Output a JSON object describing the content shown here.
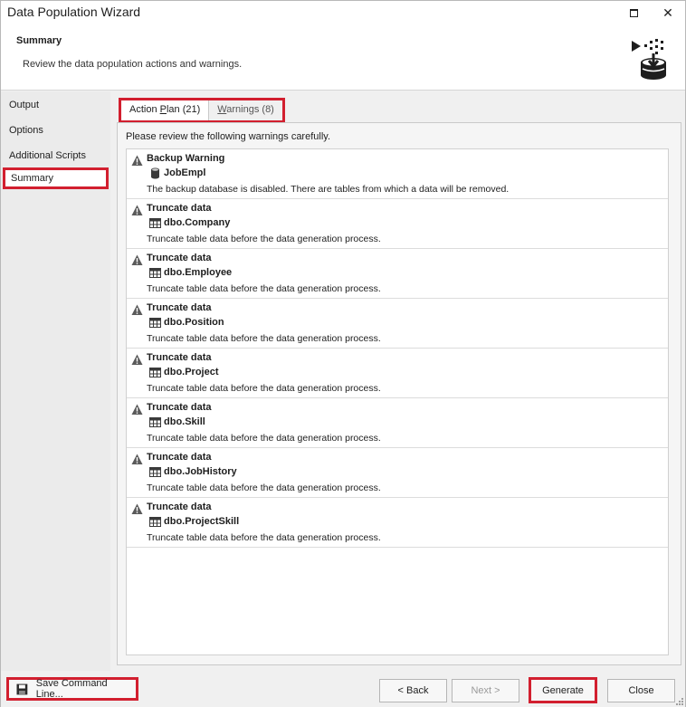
{
  "window": {
    "title": "Data Population Wizard",
    "maximize_icon": "maximize-icon",
    "close_icon": "close-icon"
  },
  "header": {
    "title": "Summary",
    "subtitle": "Review the data population actions and warnings.",
    "logo_icon": "data-population-icon"
  },
  "sidebar": {
    "items": [
      {
        "label": "Output",
        "active": false
      },
      {
        "label": "Options",
        "active": false
      },
      {
        "label": "Additional Scripts",
        "active": false
      },
      {
        "label": "Summary",
        "active": true
      }
    ]
  },
  "tabs": [
    {
      "pre": "Action ",
      "underline": "P",
      "post": "lan (21)",
      "selected": true
    },
    {
      "pre": "",
      "underline": "W",
      "post": "arnings (8)",
      "selected": false
    }
  ],
  "panel": {
    "intro": "Please review the following warnings carefully."
  },
  "warnings": [
    {
      "title": "Backup Warning",
      "object": "JobEmpl",
      "object_icon": "database-icon",
      "description": "The backup database is disabled. There are tables from which a data will be removed."
    },
    {
      "title": "Truncate data",
      "object": "dbo.Company",
      "object_icon": "table-icon",
      "description": "Truncate table data before the data generation process."
    },
    {
      "title": "Truncate data",
      "object": "dbo.Employee",
      "object_icon": "table-icon",
      "description": "Truncate table data before the data generation process."
    },
    {
      "title": "Truncate data",
      "object": "dbo.Position",
      "object_icon": "table-icon",
      "description": "Truncate table data before the data generation process."
    },
    {
      "title": "Truncate data",
      "object": "dbo.Project",
      "object_icon": "table-icon",
      "description": "Truncate table data before the data generation process."
    },
    {
      "title": "Truncate data",
      "object": "dbo.Skill",
      "object_icon": "table-icon",
      "description": "Truncate table data before the data generation process."
    },
    {
      "title": "Truncate data",
      "object": "dbo.JobHistory",
      "object_icon": "table-icon",
      "description": "Truncate table data before the data generation process."
    },
    {
      "title": "Truncate data",
      "object": "dbo.ProjectSkill",
      "object_icon": "table-icon",
      "description": "Truncate table data before the data generation process."
    }
  ],
  "footer": {
    "save_label": "Save Command Line...",
    "save_icon": "floppy-disk-icon",
    "back_label": "< Back",
    "next_label": "Next >",
    "next_enabled": false,
    "generate_label": "Generate",
    "close_label": "Close"
  },
  "colors": {
    "highlight": "#d21f2f",
    "warning_icon": "#5a5a5a"
  }
}
